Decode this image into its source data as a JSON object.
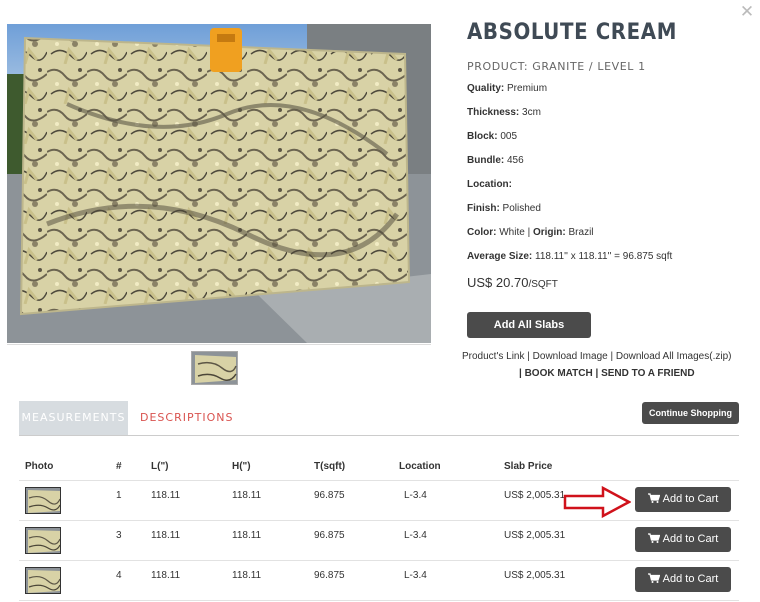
{
  "product": {
    "title": "ABSOLUTE CREAM",
    "subtitle": "PRODUCT: GRANITE / LEVEL 1",
    "attributes": [
      {
        "label": "Quality:",
        "value": " Premium"
      },
      {
        "label": "Thickness:",
        "value": " 3cm"
      },
      {
        "label": "Block:",
        "value": " 005"
      },
      {
        "label": "Bundle:",
        "value": " 456"
      },
      {
        "label": "Location:",
        "value": ""
      },
      {
        "label": "Finish:",
        "value": " Polished"
      }
    ],
    "color_label": "Color:",
    "color_value": " White | ",
    "origin_label": "Origin:",
    "origin_value": " Brazil",
    "size_label": "Average Size:",
    "size_value": " 118.11'' x 118.11'' = 96.875 sqft",
    "price": "US$ 20.70",
    "price_unit": "/SQFT",
    "add_all_label": "Add All Slabs"
  },
  "links": {
    "products_link": "Product's Link",
    "download_image": "Download Image",
    "download_all": "Download All Images(.zip)",
    "book_match": "BOOK MATCH",
    "send_friend": "SEND TO A FRIEND",
    "sep": " | "
  },
  "tabs": {
    "measurements": "MEASUREMENTS",
    "descriptions": "DESCRIPTIONS"
  },
  "continue_label": "Continue Shopping",
  "table": {
    "headers": [
      "Photo",
      "#",
      "L(\")",
      "H(\")",
      "T(sqft)",
      "Location",
      "Slab Price"
    ],
    "rows": [
      {
        "num": "1",
        "l": "118.11",
        "h": "118.11",
        "t": "96.875",
        "location": "L-3.4",
        "price": "US$ 2,005.31"
      },
      {
        "num": "3",
        "l": "118.11",
        "h": "118.11",
        "t": "96.875",
        "location": "L-3.4",
        "price": "US$ 2,005.31"
      },
      {
        "num": "4",
        "l": "118.11",
        "h": "118.11",
        "t": "96.875",
        "location": "L-3.4",
        "price": "US$ 2,005.31"
      }
    ],
    "cart_label": "Add to Cart"
  },
  "icons": {
    "close": "close-icon",
    "cart": "shopping-cart-icon",
    "arrow": "red-arrow-icon"
  },
  "colors": {
    "dark_button": "#4b4b4b",
    "tab_active": "#d7dce0",
    "tab_inactive_text": "#d9534f",
    "arrow": "#d0121b",
    "title": "#3f4a55"
  }
}
